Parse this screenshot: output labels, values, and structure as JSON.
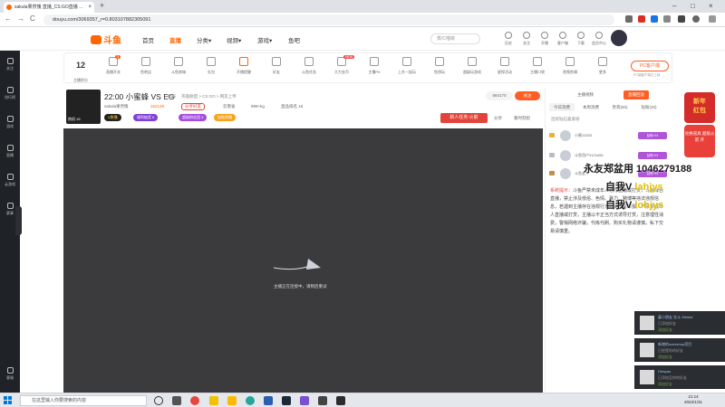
{
  "browser": {
    "tab_title": "sakula果然愧 直播_CS:GO直播 ...",
    "tab_close": "×",
    "new_tab": "+",
    "url": "douyu.com/3069357_r=0.803107882305091",
    "nav_back": "←",
    "nav_forward": "→",
    "nav_reload": "C",
    "win_minimize": "–",
    "win_maximize": "□",
    "win_close": "×"
  },
  "header": {
    "logo": "斗鱼",
    "nav": [
      "首页",
      "直播",
      "分类▾",
      "视频▾",
      "游戏▾",
      "鱼吧"
    ],
    "active_nav": 1,
    "search_placeholder": "蒸/C喵呦",
    "icons": [
      "历史",
      "关注",
      "开播",
      "客户端",
      "下载",
      "消息",
      "会员中心"
    ]
  },
  "sidenav": {
    "items": [
      "关注",
      "排行榜",
      "游戏",
      "直播",
      "云游戏",
      "赛事"
    ],
    "bottom": "客服"
  },
  "toolbar": {
    "level": "12",
    "level_label": "主播积分",
    "items": [
      "直播开关",
      "鱼吧店",
      "斗鱼商城",
      "礼包",
      "开播提醒",
      "好友",
      "斗鱼任务",
      "大力金币",
      "主播PK",
      "上升一起玩",
      "鱼鸽玩",
      "超级玩游戏",
      "星探活动",
      "主播口袋",
      "视频剪辑",
      "更多"
    ],
    "badge": "3",
    "new_badge": "NEW",
    "pc_client": "PC客户端",
    "pc_sub": "PC端客户端已上线"
  },
  "room": {
    "title": "22:00 小蜜蜂 VS EG",
    "report": "举报",
    "category": "英雄联盟 > CS:GO > 网友上传",
    "anchor_name": "sakula果然愧",
    "hot": "162128",
    "badges": [
      "分享好友",
      "主播",
      "颜值担当"
    ],
    "fans": "999+kg",
    "location": "云南省",
    "tier": "直品排名 16",
    "viewers": "684170",
    "follow": "关注",
    "pic_tag": "热机 16",
    "pill_1": "V联播",
    "pill_2": "福利抽奖 6",
    "pill_3": "超级粉丝团 3",
    "pill_4": "加贴帮播",
    "new_task": "新人任务:火箭",
    "share": "分享",
    "clip": "看时刻剪",
    "loading": "主播正在连接中，请稍后重试"
  },
  "rpanel": {
    "tabs": [
      "主播视频",
      "直播回放"
    ],
    "subtabs": [
      "今日消费",
      "本周消费",
      "贵宾(60)",
      "钻粉(20)"
    ],
    "rank_title": "连续钻石喜爱榜",
    "rows": [
      "小蜜23333",
      "斗鱼用户3123456",
      "斗鱼友..."
    ],
    "fan_badge": "钻粉·V4",
    "notice_label": "系统提示：",
    "notice": "斗鱼严禁未成年人进行直播或打赏，斗鱼绿色直播，禁止涉及低俗、色情、暴力、赌博等违法违规信息，若遇到主播存在违规行为，请及时举报。严禁未成年人直播或打赏，主播以不正当方式诱导打赏，注意理性消费，警惕网络诈骗，代练代刷、购买礼物请谨慎，私下交易请慎重。"
  },
  "danmu": {
    "line1": "永友郑盆用 1046279188",
    "line2_a": "自我V",
    "line2_b": "lahjys",
    "line3_a": "自我V",
    "line3_b": "lohjys"
  },
  "promo": {
    "top_line1": "新年",
    "top_line2": "红包",
    "bottom": "兑换道具 超级火箭 开"
  },
  "notifications": [
    {
      "title": "蔓小朋友 在斗 Weidai",
      "line2": "已添加好友",
      "line3": "添加好友"
    },
    {
      "title": "新增的workshop项目",
      "line2": "已经是你的好友",
      "line3": "添加好友"
    },
    {
      "title": "Diesyas",
      "line2": "已添加至你的好友",
      "line3": "添加好友"
    }
  ],
  "taskbar": {
    "search": "在这里输入你要搜索的内容",
    "time": "21:14",
    "date": "2022/1/31"
  },
  "colors": {
    "brand": "#ff5d23",
    "player_bg": "#3b3b3d",
    "sidenav": "#1f2327"
  }
}
